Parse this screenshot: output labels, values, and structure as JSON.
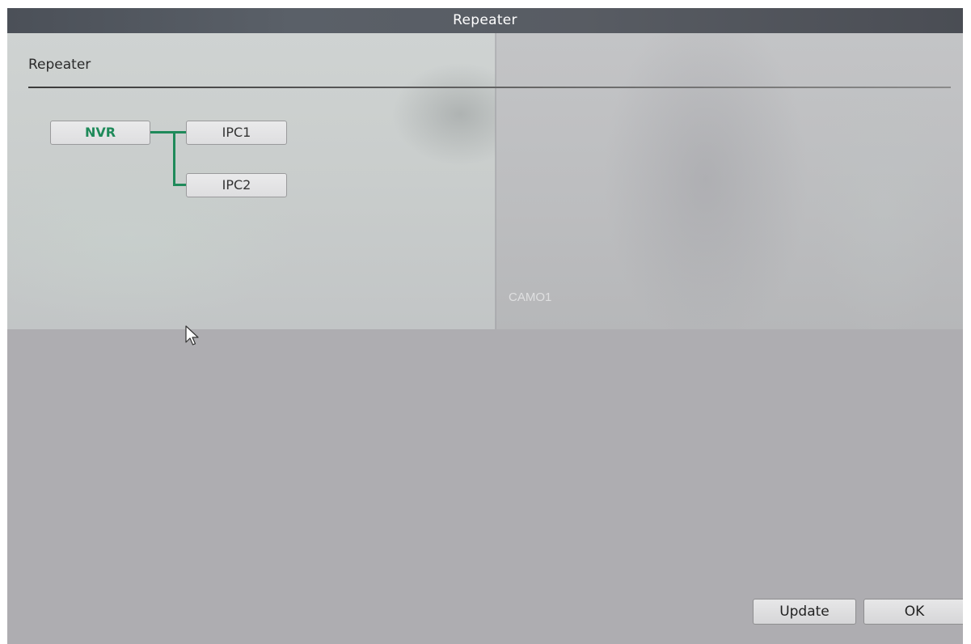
{
  "window": {
    "title": "Repeater"
  },
  "section": {
    "title": "Repeater"
  },
  "video": {
    "camera_label": "CAMO1"
  },
  "topology": {
    "root": "NVR",
    "children": [
      "IPC1",
      "IPC2"
    ],
    "line_color": "#1f8a5a"
  },
  "buttons": {
    "update_label": "Update",
    "ok_label": "OK"
  },
  "icons": {
    "cursor": "mouse-pointer-icon"
  }
}
